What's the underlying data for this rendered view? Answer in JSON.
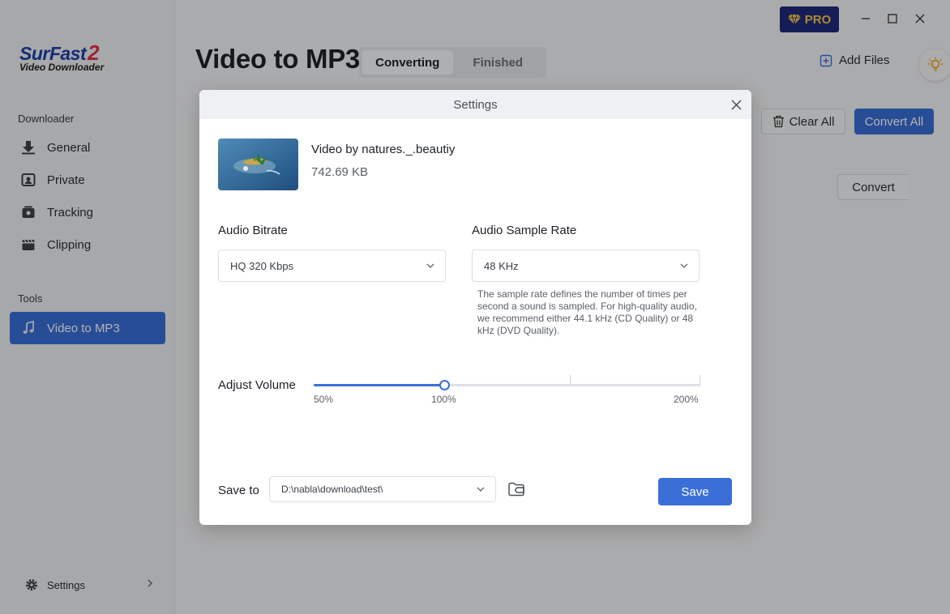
{
  "app": {
    "logo_line1": "SurFast",
    "logo_line1_suffix": "2",
    "logo_line2": "Video Downloader"
  },
  "sidebar": {
    "downloader_label": "Downloader",
    "downloader_items": [
      {
        "label": "General",
        "icon": "download-icon"
      },
      {
        "label": "Private",
        "icon": "private-icon"
      },
      {
        "label": "Tracking",
        "icon": "tracking-icon"
      },
      {
        "label": "Clipping",
        "icon": "clipping-icon"
      }
    ],
    "tools_label": "Tools",
    "tools_items": [
      {
        "label": "Video to MP3",
        "icon": "music-note-icon",
        "active": true
      }
    ],
    "settings_label": "Settings"
  },
  "header": {
    "title": "Video to MP3",
    "tabs": [
      {
        "label": "Converting",
        "active": true
      },
      {
        "label": "Finished",
        "active": false
      }
    ],
    "pro_label": "PRO",
    "add_files_label": "Add Files"
  },
  "toolbar": {
    "clear_all_label": "Clear All",
    "convert_all_label": "Convert All",
    "convert_label": "Convert"
  },
  "dialog": {
    "title": "Settings",
    "file_name": "Video by natures._.beautiy",
    "file_size": "742.69 KB",
    "audio_bitrate_label": "Audio Bitrate",
    "audio_bitrate_value": "HQ 320 Kbps",
    "sample_rate_label": "Audio Sample Rate",
    "sample_rate_value": "48 KHz",
    "sample_rate_hint": "The sample rate defines the number of times per second a sound is sampled. For high-quality audio, we recommend either 44.1 kHz (CD Quality) or 48 kHz (DVD Quality).",
    "volume_label": "Adjust Volume",
    "volume_min_label": "50%",
    "volume_mid_label": "100%",
    "volume_max_label": "200%",
    "volume_value_percent": 100,
    "save_to_label": "Save to",
    "save_path": "D:\\nabla\\download\\test\\",
    "save_button": "Save"
  },
  "colors": {
    "accent": "#3a6fd8",
    "pro_bg": "#1d2a7a",
    "pro_text": "#f5c64f",
    "logo_blue": "#1e3fa8",
    "logo_red": "#e5304a"
  }
}
